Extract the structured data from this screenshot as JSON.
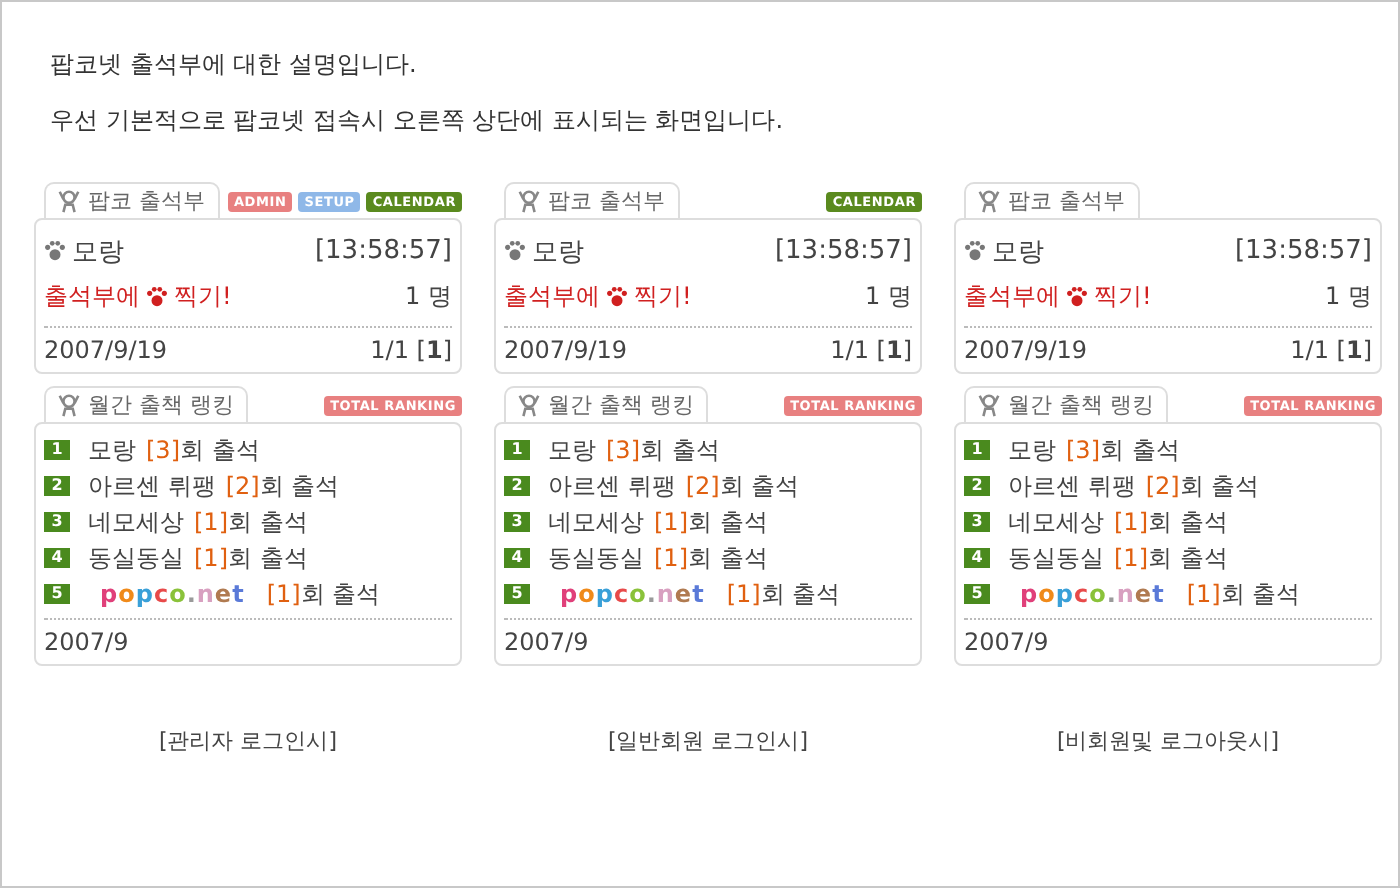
{
  "intro": [
    "팝코넷 출석부에 대한 설명입니다.",
    "우선 기본적으로 팝코넷 접속시 오른쪽 상단에 표시되는 화면입니다."
  ],
  "panels": [
    {
      "attendance": {
        "tab": "팝코 출석부",
        "badges": [
          {
            "label": "ADMIN",
            "color": "#e88080"
          },
          {
            "label": "SETUP",
            "color": "#8fb8e8"
          },
          {
            "label": "CALENDAR",
            "color": "#5a8a1e"
          }
        ],
        "user": "모랑",
        "time": "[13:58:57]",
        "checkin": "출석부에",
        "checkin_tail": "찍기!",
        "count": "1 명",
        "date": "2007/9/19",
        "pages": "1/1 [**1**]"
      },
      "ranking": {
        "tab": "월간 출책 랭킹",
        "badge": {
          "label": "TOTAL RANKING",
          "color": "#e88080"
        },
        "entries": [
          {
            "rank": "1",
            "kind": "text",
            "name": "모랑",
            "text": "**[3]**회 출석"
          },
          {
            "rank": "2",
            "kind": "text",
            "name": "아르센 뤼팽",
            "text": "**[2]**회 출석"
          },
          {
            "rank": "3",
            "kind": "text",
            "name": "네모세상",
            "text": "**[1]**회 출석"
          },
          {
            "rank": "4",
            "kind": "text",
            "name": "동실동실",
            "text": "**[1]**회 출석"
          },
          {
            "rank": "5",
            "kind": "logo",
            "name": "popco.net",
            "text": "**[1]**회 출석"
          }
        ],
        "month": "2007/9"
      },
      "caption": "[관리자 로그인시]"
    },
    {
      "attendance": {
        "tab": "팝코 출석부",
        "badges": [
          {
            "label": "CALENDAR",
            "color": "#5a8a1e"
          }
        ],
        "user": "모랑",
        "time": "[13:58:57]",
        "checkin": "출석부에",
        "checkin_tail": "찍기!",
        "count": "1 명",
        "date": "2007/9/19",
        "pages": "1/1 [**1**]"
      },
      "ranking": {
        "tab": "월간 출책 랭킹",
        "badge": {
          "label": "TOTAL RANKING",
          "color": "#e88080"
        },
        "entries": [
          {
            "rank": "1",
            "kind": "text",
            "name": "모랑",
            "text": "**[3]**회 출석"
          },
          {
            "rank": "2",
            "kind": "text",
            "name": "아르센 뤼팽",
            "text": "**[2]**회 출석"
          },
          {
            "rank": "3",
            "kind": "text",
            "name": "네모세상",
            "text": "**[1]**회 출석"
          },
          {
            "rank": "4",
            "kind": "text",
            "name": "동실동실",
            "text": "**[1]**회 출석"
          },
          {
            "rank": "5",
            "kind": "logo",
            "name": "popco.net",
            "text": "**[1]**회 출석"
          }
        ],
        "month": "2007/9"
      },
      "caption": "[일반회원 로그인시]"
    },
    {
      "attendance": {
        "tab": "팝코 출석부",
        "user": "모랑",
        "time": "[13:58:57]",
        "checkin": "출석부에",
        "checkin_tail": "찍기!",
        "count": "1 명",
        "date": "2007/9/19",
        "pages": "1/1 [**1**]"
      },
      "ranking": {
        "tab": "월간 출책 랭킹",
        "badge": {
          "label": "TOTAL RANKING",
          "color": "#e88080"
        },
        "entries": [
          {
            "rank": "1",
            "kind": "text",
            "name": "모랑",
            "text": "**[3]**회 출석"
          },
          {
            "rank": "2",
            "kind": "text",
            "name": "아르센 뤼팽",
            "text": "**[2]**회 출석"
          },
          {
            "rank": "3",
            "kind": "text",
            "name": "네모세상",
            "text": "**[1]**회 출석"
          },
          {
            "rank": "4",
            "kind": "text",
            "name": "동실동실",
            "text": "**[1]**회 출석"
          },
          {
            "rank": "5",
            "kind": "logo",
            "name": "popco.net",
            "text": "**[1]**회 출석"
          }
        ],
        "month": "2007/9"
      },
      "caption": "[비회원및 로그아웃시]"
    }
  ]
}
